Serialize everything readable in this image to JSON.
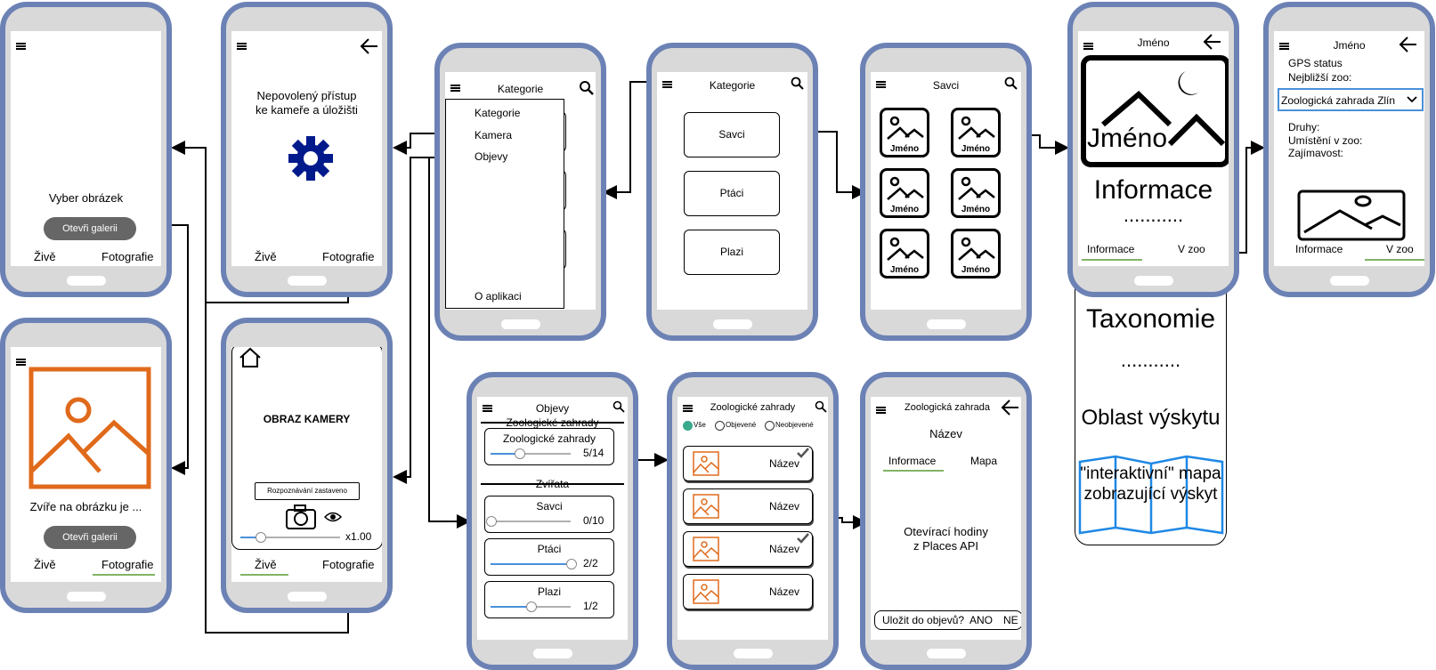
{
  "phone1": {
    "prompt": "Vyber obrázek",
    "button": "Otevři galerii",
    "tab_live": "Živě",
    "tab_photo": "Fotografie"
  },
  "phone2": {
    "message": "Nepovolený přístup ke kameře a úložišti",
    "tab_live": "Živě",
    "tab_photo": "Fotografie"
  },
  "phone3": {
    "result": "Zvíře na obrázku je ...",
    "button": "Otevři galerii",
    "tab_live": "Živě",
    "tab_photo": "Fotografie"
  },
  "phone4": {
    "title": "OBRAZ KAMERY",
    "status": "Rozpoznávání zastaveno",
    "zoom": "x1.00",
    "tab_live": "Živě",
    "tab_photo": "Fotografie"
  },
  "phone5": {
    "title": "Kategorie",
    "menu": [
      "Kategorie",
      "Kamera",
      "Objevy"
    ],
    "about": "O aplikaci"
  },
  "phone6": {
    "title": "Kategorie",
    "buttons": [
      "Savci",
      "Ptáci",
      "Plazi"
    ]
  },
  "phone7": {
    "title": "Savci",
    "thumb_label": "Jméno"
  },
  "phone8": {
    "title": "Jméno",
    "overlay_name": "Jméno",
    "info": "Informace",
    "dots": "...........",
    "tab_info": "Informace",
    "tab_zoo": "V zoo",
    "ext_taxonomy": "Taxonomie",
    "ext_dots": "...........",
    "ext_area": "Oblast výskytu",
    "ext_map": "\"interaktivní\" mapa zobrazující výskyt"
  },
  "phone9": {
    "title": "Jméno",
    "gps": "GPS status",
    "nearest": "Nejbližší zoo:",
    "zoo_select": "Zoologická zahrada Zlín",
    "species": "Druhy:",
    "placement": "Umístění v zoo:",
    "interesting": "Zajímavost:",
    "tab_info": "Informace",
    "tab_zoo": "V zoo"
  },
  "phone10": {
    "title": "Objevy",
    "section_zoo": "Zoologické zahrady",
    "section_animals": "Zvířata",
    "cards": [
      {
        "label": "Zoologické zahrady",
        "count": "5/14",
        "fraction": 0.357
      },
      {
        "label": "Savci",
        "count": "0/10",
        "fraction": 0.0
      },
      {
        "label": "Ptáci",
        "count": "2/2",
        "fraction": 1.0
      },
      {
        "label": "Plazi",
        "count": "1/2",
        "fraction": 0.5
      }
    ]
  },
  "phone11": {
    "title": "Zoologické zahrady",
    "filters": [
      "Vše",
      "Objevené",
      "Neobjevené"
    ],
    "item_label": "Název"
  },
  "phone12": {
    "title": "Zoologická zahrada",
    "name": "Název",
    "tab_info": "Informace",
    "tab_map": "Mapa",
    "hours": "Otevírací hodiny",
    "hours_src": "z Places API",
    "save_prompt": "Uložit do objevů?",
    "yes": "ANO",
    "no": "NE"
  },
  "colors": {
    "frame": "#6c82b5",
    "accent_orange": "#e06a1b",
    "tab_green": "#82b366",
    "slider_blue": "#4a90d9",
    "gear_blue": "#001a8c",
    "map_blue": "#1e88e5"
  },
  "icons": [
    "menu-icon",
    "search-icon",
    "back-arrow-icon",
    "gear-icon",
    "image-icon",
    "home-icon",
    "camera-icon",
    "eye-icon",
    "check-icon",
    "chevron-down-icon",
    "map-icon"
  ]
}
